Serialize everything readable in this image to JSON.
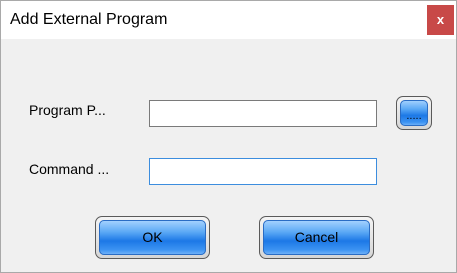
{
  "dialog": {
    "title": "Add External Program",
    "close_glyph": "x"
  },
  "form": {
    "program_path_label": "Program P...",
    "program_path_value": "",
    "browse_label": ".....",
    "command_label": "Command ...",
    "command_value": ""
  },
  "buttons": {
    "ok_label": "OK",
    "cancel_label": "Cancel"
  },
  "colors": {
    "close_button": "#c84948",
    "button_blue": "#1c78e6",
    "focus_border": "#3c8dde",
    "dialog_body": "#f0f0f0"
  }
}
